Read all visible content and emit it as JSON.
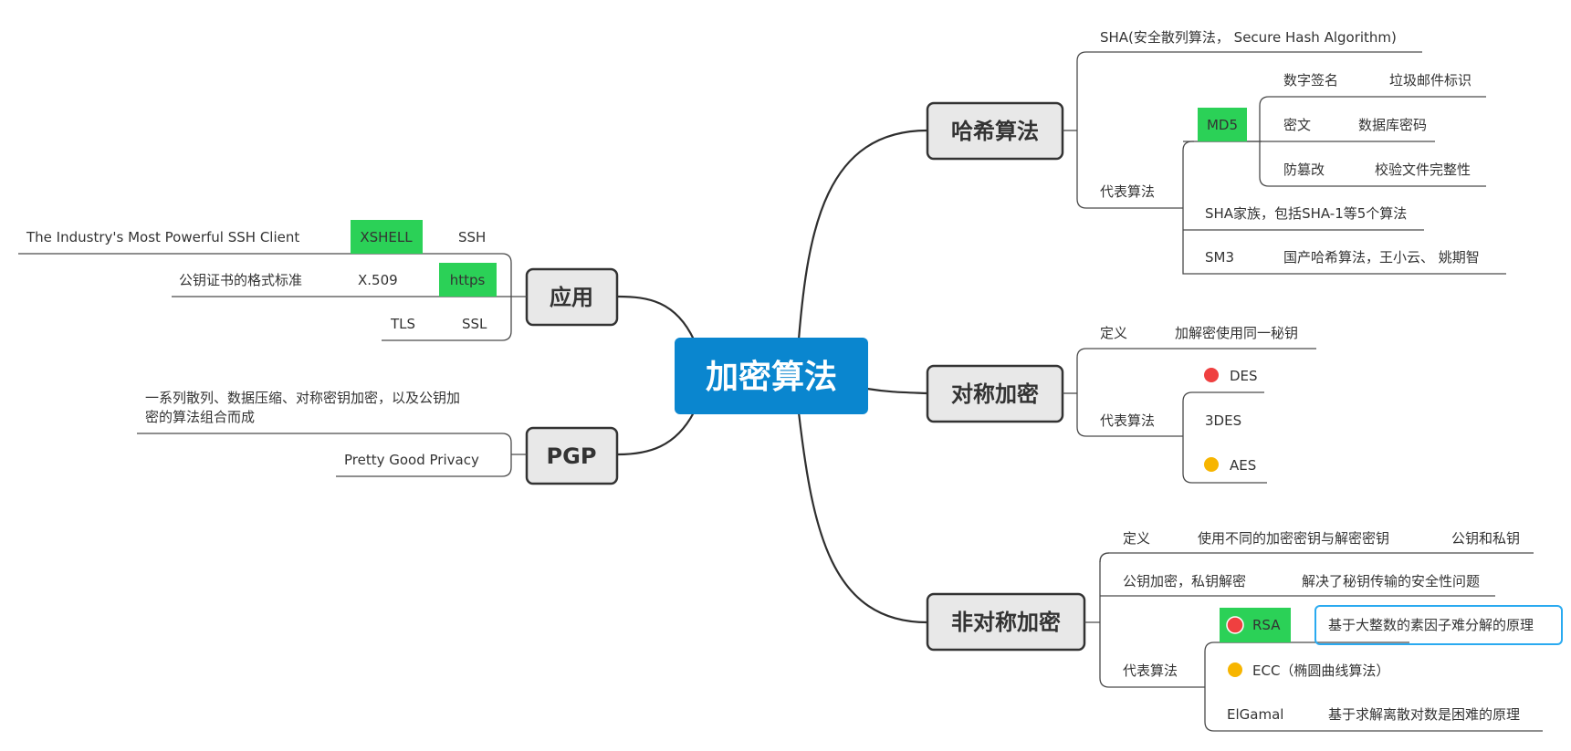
{
  "root": {
    "title": "加密算法",
    "color": "#0a86cf"
  },
  "colors": {
    "highlight": "#2bd157",
    "marker_red": "#ef4040",
    "marker_orange": "#f7b500",
    "selection": "#2aaaf0"
  },
  "hash": {
    "title": "哈希算法",
    "sha": "SHA(安全散列算法， Secure Hash Algorithm)",
    "rep_label": "代表算法",
    "md5": "MD5",
    "md5_children": [
      {
        "a": "数字签名",
        "b": "垃圾邮件标识"
      },
      {
        "a": "密文",
        "b": "数据库密码"
      },
      {
        "a": "防篡改",
        "b": "校验文件完整性"
      }
    ],
    "sha_family": "SHA家族，包括SHA-1等5个算法",
    "sm3": "SM3",
    "sm3_desc": "国产哈希算法，王小云、 姚期智"
  },
  "symmetric": {
    "title": "对称加密",
    "def_label": "定义",
    "def_value": "加解密使用同一秘钥",
    "rep_label": "代表算法",
    "algos": [
      {
        "name": "DES",
        "marker": "red"
      },
      {
        "name": "3DES",
        "marker": ""
      },
      {
        "name": "AES",
        "marker": "orange"
      }
    ]
  },
  "asymmetric": {
    "title": "非对称加密",
    "def_label": "定义",
    "def_value": "使用不同的加密密钥与解密密钥",
    "def_extra": "公钥和私钥",
    "pub_label": "公钥加密，私钥解密",
    "pub_value": "解决了秘钥传输的安全性问题",
    "rep_label": "代表算法",
    "rsa": "RSA",
    "rsa_desc": "基于大整数的素因子难分解的原理",
    "ecc": "ECC（椭圆曲线算法）",
    "elgamal": "ElGamal",
    "elgamal_desc": "基于求解离散对数是困难的原理"
  },
  "apps": {
    "title": "应用",
    "ssh": "SSH",
    "xshell": "XSHELL",
    "xshell_desc": "The Industry's Most Powerful SSH Client",
    "https": "https",
    "x509": "X.509",
    "x509_desc": "公钥证书的格式标准",
    "ssl": "SSL",
    "tls": "TLS"
  },
  "pgp": {
    "title": "PGP",
    "desc_line1": "一系列散列、数据压缩、对称密钥加密，以及公钥加",
    "desc_line2": "密的算法组合而成",
    "fullname": "Pretty Good Privacy"
  }
}
